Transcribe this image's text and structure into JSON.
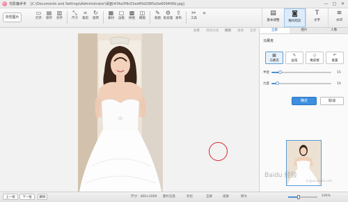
{
  "titlebar": {
    "app_name": "光影魔术手",
    "file_path": "[C:\\Documents and Settings\\Administrator\\桌面\\434a3f9c01ed45d2965a5e609406b.jpg]",
    "controls": [
      "—",
      "□",
      "✕"
    ]
  },
  "toolbar": {
    "browse_label": "浏览图片",
    "tools": [
      {
        "label": "打开",
        "icon": "open-icon",
        "glyph": "▭"
      },
      {
        "label": "保存",
        "icon": "save-icon",
        "glyph": "▤"
      },
      {
        "label": "另存",
        "icon": "save-as-icon",
        "glyph": "▥"
      },
      {
        "label": "尺寸",
        "icon": "resize-icon",
        "glyph": "⤡"
      },
      {
        "label": "裁剪",
        "icon": "crop-icon",
        "glyph": "⌗"
      },
      {
        "label": "旋转",
        "icon": "rotate-icon",
        "glyph": "↻"
      },
      {
        "label": "素材",
        "icon": "material-icon",
        "glyph": "▦"
      },
      {
        "label": "边框",
        "icon": "border-icon",
        "glyph": "▢"
      },
      {
        "label": "拼图",
        "icon": "collage-icon",
        "glyph": "▩"
      },
      {
        "label": "模版",
        "icon": "template-icon",
        "glyph": "◫"
      },
      {
        "label": "抠图",
        "icon": "cutout-icon",
        "glyph": "✎"
      },
      {
        "label": "批处理",
        "icon": "batch-icon",
        "glyph": "⚙"
      },
      {
        "label": "发布",
        "icon": "publish-icon",
        "glyph": "⇪"
      },
      {
        "label": "工具",
        "icon": "tools-icon",
        "glyph": "✂"
      },
      {
        "label": "",
        "icon": "more-icon",
        "glyph": "»"
      }
    ]
  },
  "mode_tabs": [
    {
      "label": "基本调整",
      "icon": "basic-adjust-icon",
      "glyph": "▤",
      "active": false
    },
    {
      "label": "数码暗房",
      "icon": "darkroom-icon",
      "glyph": "◙",
      "active": true
    },
    {
      "label": "文字",
      "icon": "text-icon",
      "glyph": "T",
      "active": false
    },
    {
      "label": "水印",
      "icon": "watermark-icon",
      "glyph": "≋",
      "active": false
    }
  ],
  "subbar": {
    "items": [
      {
        "label": "分享",
        "disabled": false
      },
      {
        "label": "清除光线",
        "disabled": true
      },
      {
        "label": "撤销",
        "disabled": false
      },
      {
        "label": "重做",
        "disabled": true
      },
      {
        "label": "还原",
        "disabled": true
      }
    ]
  },
  "panel": {
    "tabs": [
      {
        "label": "全部",
        "active": true
      },
      {
        "label": "图片",
        "active": false
      },
      {
        "label": "人像",
        "active": false
      }
    ],
    "section_title": "马赛克",
    "brush_buttons": [
      {
        "label": "马赛克",
        "icon": "mosaic-icon",
        "glyph": "▦",
        "active": true
      },
      {
        "label": "画笔",
        "icon": "brush-icon",
        "glyph": "✎",
        "active": false
      },
      {
        "label": "橡皮擦",
        "icon": "eraser-icon",
        "glyph": "◇",
        "active": false
      },
      {
        "label": "重置",
        "icon": "reset-icon",
        "glyph": "↶",
        "active": false
      }
    ],
    "sliders": [
      {
        "label": "半径",
        "value": 15,
        "min": 0,
        "max": 100
      },
      {
        "label": "力度",
        "value": 10,
        "min": 0,
        "max": 100
      }
    ],
    "apply_label": "确定",
    "cancel_label": "取消"
  },
  "watermark": {
    "text": "Baidu 经验",
    "url": "jingyan.baidu.com"
  },
  "statusbar": {
    "prev_label": "上一张",
    "next_label": "下一张",
    "delete_label": "删除",
    "size_text": "尺寸：400×1009",
    "info_label": "图片信息",
    "compare_label": "对比",
    "fullscreen_label": "全屏",
    "fit_label": "适屏",
    "original_label": "原大",
    "zoom_fraction": 0.35,
    "zoom_text": "100%"
  }
}
